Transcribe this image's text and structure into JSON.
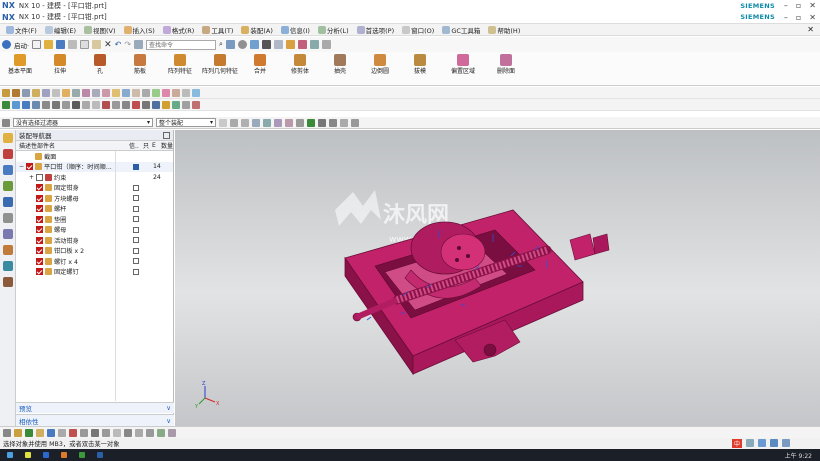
{
  "app": {
    "logo": "NX",
    "title_outer": "NX 10 - 建模 - [平口钳.prt]",
    "title_inner": "NX 10 - 建模 - [平口钳.prt]",
    "brand": "SIEMENS"
  },
  "menu": [
    "文件(F)",
    "编辑(E)",
    "视图(V)",
    "插入(S)",
    "格式(R)",
    "工具(T)",
    "装配(A)",
    "信息(I)",
    "分析(L)",
    "首选项(P)",
    "窗口(O)",
    "GC工具箱",
    "帮助(H)"
  ],
  "quick": {
    "start_label": "启动·",
    "search_placeholder": "查找命令"
  },
  "ribbon": [
    {
      "label": "基本平面",
      "color": "#e09a2a"
    },
    {
      "label": "拉伸",
      "color": "#d58a2a"
    },
    {
      "label": "孔",
      "color": "#b75a2a"
    },
    {
      "label": "筋板",
      "color": "#c77a40"
    },
    {
      "label": "阵列特征",
      "color": "#cf8a30"
    },
    {
      "label": "阵列几何特征",
      "color": "#c47a2f"
    },
    {
      "label": "合并",
      "color": "#d07a30"
    },
    {
      "label": "修剪体",
      "color": "#c48a3a"
    },
    {
      "label": "抽壳",
      "color": "#a07a5a"
    },
    {
      "label": "边倒圆",
      "color": "#d08a40"
    },
    {
      "label": "拔模",
      "color": "#b98a40"
    },
    {
      "label": "偏置区域",
      "color": "#d06a9a"
    },
    {
      "label": "删除面",
      "color": "#c0709a"
    }
  ],
  "filter": {
    "selection_filter": "没有选择过滤器",
    "assembly_scope": "整个装配"
  },
  "navigator": {
    "title": "装配导航器",
    "columns": {
      "name": "描述性部件名",
      "info": "信..",
      "r": "只",
      "m": "E",
      "count": "数量"
    },
    "rows": [
      {
        "label": "截面",
        "checked": false,
        "indent": 0,
        "box": false,
        "count": ""
      },
      {
        "label": "平口钳（顺序：时间顺...",
        "checked": true,
        "indent": 0,
        "box": true,
        "count": "14"
      },
      {
        "label": "约束",
        "checked": false,
        "indent": 1,
        "box": false,
        "count": "24"
      },
      {
        "label": "固定钳身",
        "checked": true,
        "indent": 1,
        "box": true,
        "count": ""
      },
      {
        "label": "方块螺母",
        "checked": true,
        "indent": 1,
        "box": true,
        "count": ""
      },
      {
        "label": "螺杆",
        "checked": true,
        "indent": 1,
        "box": true,
        "count": ""
      },
      {
        "label": "垫圈",
        "checked": true,
        "indent": 1,
        "box": true,
        "count": ""
      },
      {
        "label": "螺母",
        "checked": true,
        "indent": 1,
        "box": true,
        "count": ""
      },
      {
        "label": "活动钳身",
        "checked": true,
        "indent": 1,
        "box": true,
        "count": ""
      },
      {
        "label": "钳口板 x 2",
        "checked": true,
        "indent": 1,
        "box": true,
        "count": ""
      },
      {
        "label": "螺钉 x 4",
        "checked": true,
        "indent": 1,
        "box": true,
        "count": ""
      },
      {
        "label": "固定螺钉",
        "checked": true,
        "indent": 1,
        "box": true,
        "count": ""
      }
    ],
    "foot_preview": "预览",
    "foot_depend": "相依性"
  },
  "watermark": {
    "brand": "沐风网",
    "url": "www.mfcad.com"
  },
  "status": "选择对象并使用 MB3，或者双击某一对象",
  "taskbar": {
    "time": "上午 9:22",
    "ime": "中"
  },
  "colors": {
    "part": "#c2226a",
    "part_dark": "#8a1249",
    "accent": "#2a5fa8"
  }
}
